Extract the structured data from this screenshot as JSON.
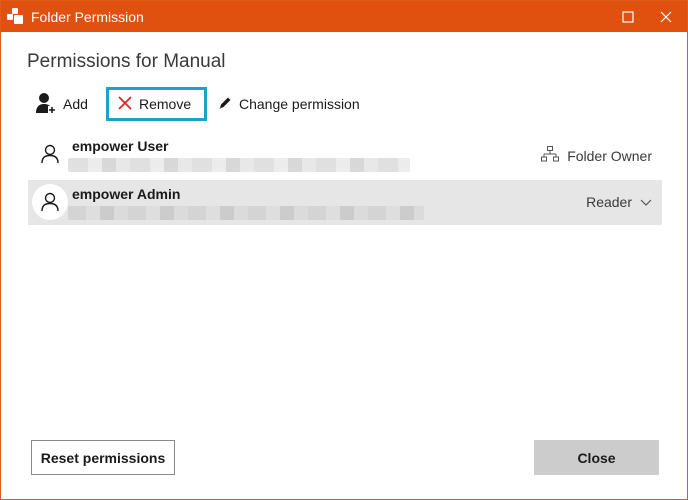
{
  "window": {
    "title": "Folder Permission",
    "accent_color": "#e0500f",
    "highlight_color": "#1aa3c4"
  },
  "heading": "Permissions for Manual",
  "toolbar": {
    "add_label": "Add",
    "remove_label": "Remove",
    "change_label": "Change permission"
  },
  "users": [
    {
      "name": "empower User",
      "role": "Folder Owner",
      "role_icon": "hierarchy-icon",
      "selected": false
    },
    {
      "name": "empower Admin",
      "role": "Reader",
      "role_icon": "chevron-down-icon",
      "selected": true
    }
  ],
  "footer": {
    "reset_label": "Reset permissions",
    "close_label": "Close"
  }
}
